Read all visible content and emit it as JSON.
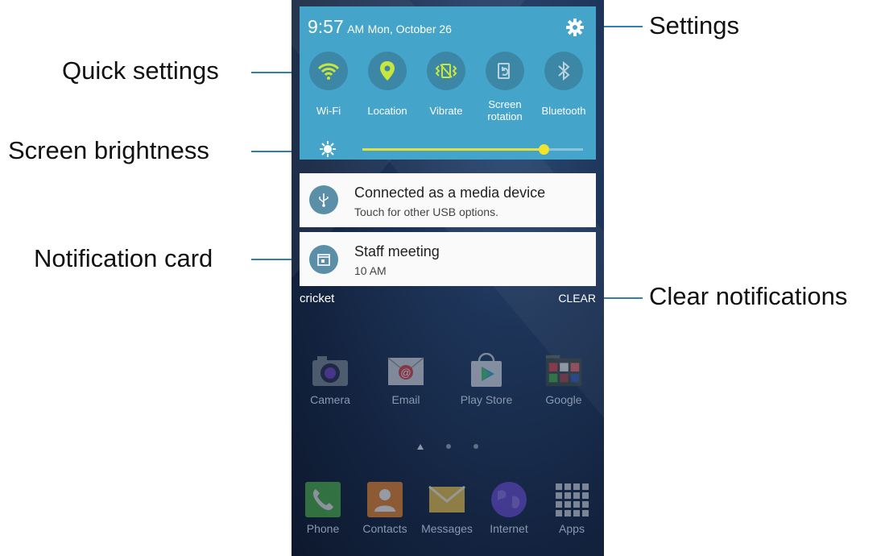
{
  "callouts": {
    "settings": "Settings",
    "quick_settings": "Quick settings",
    "screen_brightness": "Screen brightness",
    "notification_card": "Notification card",
    "clear_notifications": "Clear notifications"
  },
  "status": {
    "time": "9:57",
    "ampm": "AM",
    "date": "Mon, October 26"
  },
  "quick_settings": [
    {
      "label": "Wi-Fi",
      "icon": "wifi-icon"
    },
    {
      "label": "Location",
      "icon": "location-icon"
    },
    {
      "label": "Vibrate",
      "icon": "vibrate-icon"
    },
    {
      "label_line1": "Screen",
      "label_line2": "rotation",
      "icon": "screen-rotation-icon"
    },
    {
      "label": "Bluetooth",
      "icon": "bluetooth-icon"
    }
  ],
  "brightness": {
    "level": 0.82
  },
  "notifications": [
    {
      "title": "Connected as a media device",
      "subtitle": "Touch for other USB options.",
      "icon": "usb-icon"
    },
    {
      "title": "Staff meeting",
      "subtitle": "10 AM",
      "icon": "calendar-icon"
    }
  ],
  "carrier": "cricket",
  "clear_label": "CLEAR",
  "home_apps": [
    {
      "label": "Camera",
      "icon": "camera-icon"
    },
    {
      "label": "Email",
      "icon": "email-icon"
    },
    {
      "label": "Play Store",
      "icon": "play-store-icon"
    },
    {
      "label": "Google",
      "icon": "google-folder-icon"
    }
  ],
  "dock_apps": [
    {
      "label": "Phone",
      "icon": "phone-icon"
    },
    {
      "label": "Contacts",
      "icon": "contacts-icon"
    },
    {
      "label": "Messages",
      "icon": "messages-icon"
    },
    {
      "label": "Internet",
      "icon": "internet-icon"
    },
    {
      "label": "Apps",
      "icon": "apps-grid-icon"
    }
  ],
  "colors": {
    "panel": "#45a4c9",
    "accent_icon": "#c8e63c",
    "callout_line": "#2f7fb5",
    "slider": "#e6e03c"
  }
}
